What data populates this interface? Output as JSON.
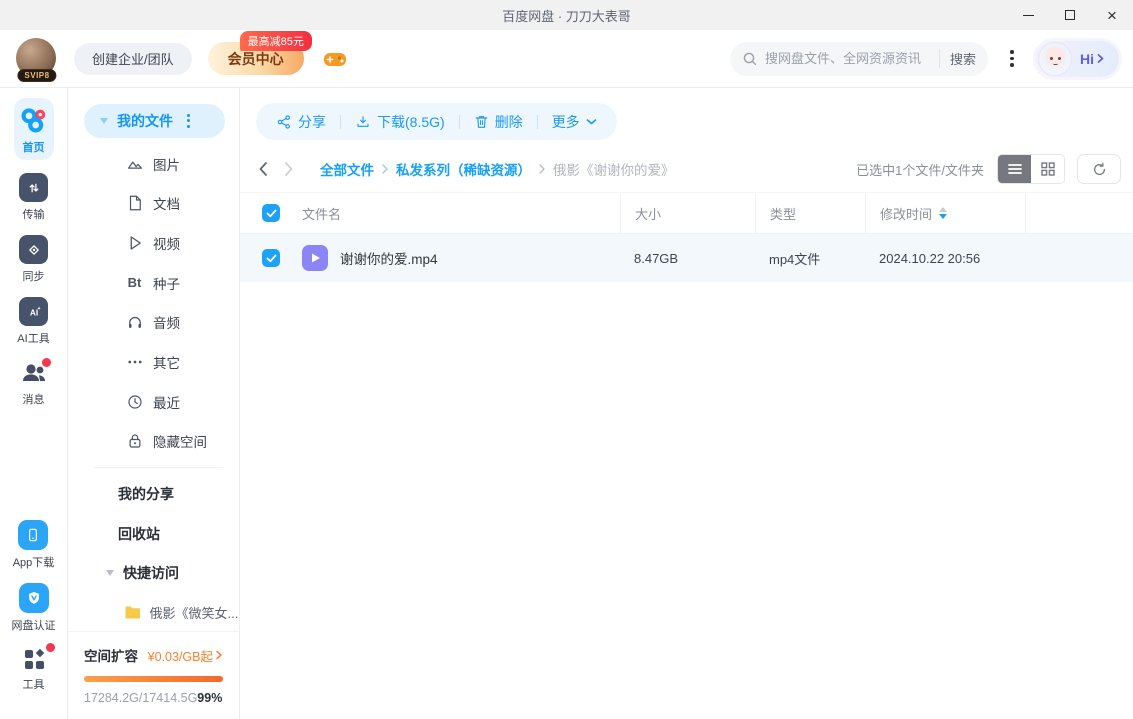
{
  "colors": {
    "accent": "#16a0f6",
    "vip_badge_red": "#f22f3f",
    "progress_orange": "#f4692a",
    "folder_yellow": "#f7c948",
    "video_purple": "#8b85f6"
  },
  "titlebar": {
    "title": "百度网盘 · 刀刀大表哥"
  },
  "header": {
    "avatar_badge": "SVIP8",
    "create_team_label": "创建企业/团队",
    "vip_center_label": "会员中心",
    "vip_badge": "最高减85元",
    "search": {
      "placeholder": "搜网盘文件、全网资源资讯",
      "button_label": "搜索"
    },
    "assistant_label": "Hi"
  },
  "rail": {
    "items": [
      {
        "label": "首页"
      },
      {
        "label": "传输"
      },
      {
        "label": "同步"
      },
      {
        "label": "AI工具"
      },
      {
        "label": "消息"
      }
    ],
    "bottom": [
      {
        "label": "App下载"
      },
      {
        "label": "网盘认证"
      },
      {
        "label": "工具"
      }
    ]
  },
  "sidebar": {
    "my_files_label": "我的文件",
    "categories": [
      {
        "label": "图片"
      },
      {
        "label": "文档"
      },
      {
        "label": "视频"
      },
      {
        "label": "种子",
        "glyph": "Bt"
      },
      {
        "label": "音频"
      },
      {
        "label": "其它"
      },
      {
        "label": "最近"
      },
      {
        "label": "隐藏空间"
      }
    ],
    "shares_label": "我的分享",
    "trash_label": "回收站",
    "quick_access_label": "快捷访问",
    "quick_items": [
      {
        "label": "俄影《微笑女..."
      }
    ],
    "storage": {
      "title": "空间扩容",
      "price": "¥0.03/GB起",
      "usage": "17284.2G/17414.5G",
      "percent": "99%"
    }
  },
  "toolbar": {
    "share_label": "分享",
    "download_label": "下载(8.5G)",
    "delete_label": "删除",
    "more_label": "更多"
  },
  "breadcrumb": {
    "items": [
      "全部文件",
      "私发系列（稀缺资源）",
      "俄影《谢谢你的爱》"
    ]
  },
  "content": {
    "selection_info": "已选中1个文件/文件夹"
  },
  "table": {
    "headers": [
      "文件名",
      "大小",
      "类型",
      "修改时间"
    ],
    "rows": [
      {
        "name": "谢谢你的爱.mp4",
        "size": "8.47GB",
        "type": "mp4文件",
        "modified": "2024.10.22 20:56"
      }
    ]
  }
}
